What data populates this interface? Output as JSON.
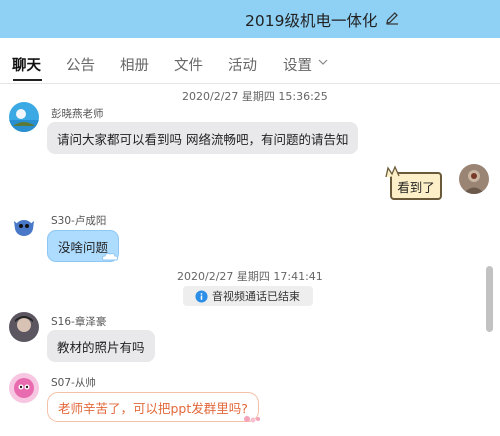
{
  "header": {
    "title": "2019级机电一体化"
  },
  "tabs": [
    {
      "label": "聊天",
      "active": true
    },
    {
      "label": "公告"
    },
    {
      "label": "相册"
    },
    {
      "label": "文件"
    },
    {
      "label": "活动"
    },
    {
      "label": "设置"
    }
  ],
  "messages": {
    "ts1": "2020/2/27 星期四 15:36:25",
    "m1": {
      "sender": "彭晓燕老师",
      "text": "请问大家都可以看到吗 网络流畅吧，有问题的请告知"
    },
    "m2": {
      "text": "看到了"
    },
    "m3": {
      "sender": "S30-卢成阳",
      "text": "没啥问题"
    },
    "ts2": "2020/2/27 星期四 17:41:41",
    "system": "音视频通话已结束",
    "m4": {
      "sender": "S16-章泽豪",
      "text": "教材的照片有吗"
    },
    "m5": {
      "sender": "S07-从帅",
      "text": "老师辛苦了，可以把ppt发群里吗?"
    }
  },
  "colors": {
    "titlebar_bg": "#8fd0f5",
    "blue_bubble": "#aedcff",
    "gray_bubble": "#e9e9ec",
    "pink_text": "#e2683a",
    "cream_bubble": "#fdf0c8"
  },
  "icons": [
    "edit-icon",
    "chevron-down-icon",
    "collapse-chevron-icon",
    "info-icon"
  ]
}
